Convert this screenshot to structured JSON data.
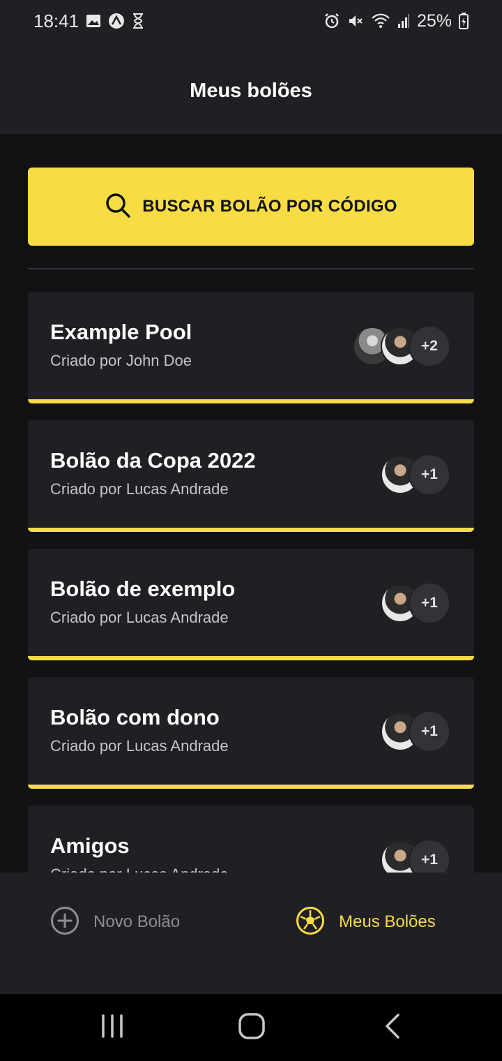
{
  "status_bar": {
    "time": "18:41",
    "battery_percent": "25%",
    "left_icons": [
      "image-icon",
      "expo-icon",
      "hourglass-icon"
    ],
    "right_icons": [
      "alarm-icon",
      "mute-icon",
      "wifi-icon",
      "signal-icon",
      "battery-charging-icon"
    ]
  },
  "header": {
    "title": "Meus bolões"
  },
  "search": {
    "label": "BUSCAR BOLÃO POR CÓDIGO",
    "icon": "search-icon"
  },
  "pools": [
    {
      "title": "Example Pool",
      "owner": "Criado por John Doe",
      "avatars": 2,
      "extra": "+2"
    },
    {
      "title": "Bolão da Copa 2022",
      "owner": "Criado por Lucas Andrade",
      "avatars": 1,
      "extra": "+1"
    },
    {
      "title": "Bolão de exemplo",
      "owner": "Criado por Lucas Andrade",
      "avatars": 1,
      "extra": "+1"
    },
    {
      "title": "Bolão com dono",
      "owner": "Criado por Lucas Andrade",
      "avatars": 1,
      "extra": "+1"
    },
    {
      "title": "Amigos",
      "owner": "Criado por Lucas Andrade",
      "avatars": 1,
      "extra": "+1"
    }
  ],
  "tabs": {
    "new_pool": {
      "label": "Novo Bolão",
      "icon": "plus-circle-icon"
    },
    "my_pools": {
      "label": "Meus Bolões",
      "icon": "soccer-ball-icon",
      "active": true
    }
  },
  "colors": {
    "accent": "#F7DD43",
    "background": "#121214",
    "surface": "#202024",
    "muted_text": "#8D8D99"
  }
}
